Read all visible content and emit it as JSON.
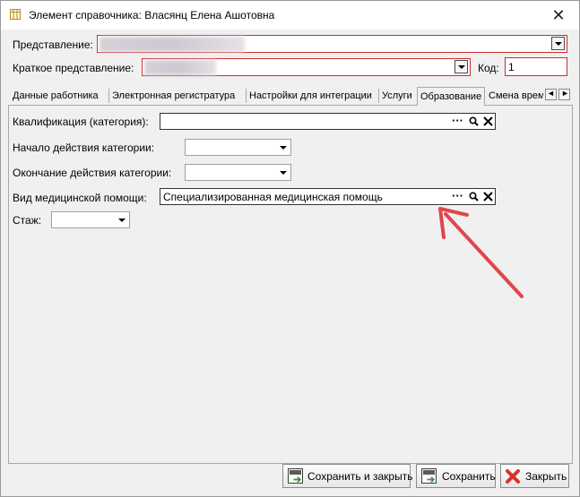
{
  "window": {
    "title": "Элемент справочника: Власянц Елена Ашотовна",
    "close_glyph": "✕"
  },
  "header": {
    "representation_label": "Представление:",
    "short_representation_label": "Краткое представление:",
    "code_label": "Код:",
    "code_value": "1"
  },
  "tabs": [
    {
      "label": "Данные работника"
    },
    {
      "label": "Электронная регистратура"
    },
    {
      "label": "Настройки для интеграции"
    },
    {
      "label": "Услуги"
    },
    {
      "label": "Образование"
    },
    {
      "label": "Смена врем"
    }
  ],
  "tab_nav": {
    "prev": "◄",
    "next": "►"
  },
  "form": {
    "qualification_label": "Квалификация (категория):",
    "qualification_value": "",
    "category_start_label": "Начало действия категории:",
    "category_end_label": "Окончание действия категории:",
    "care_type_label": "Вид медицинской помощи:",
    "care_type_value": "Специализированная медицинская помощь",
    "experience_label": "Стаж:"
  },
  "field_buttons": {
    "select": "···",
    "search": "🔍",
    "clear": "✕"
  },
  "buttons": {
    "save_close": "Сохранить и закрыть",
    "save": "Сохранить",
    "close": "Закрыть"
  },
  "colors": {
    "accent_red": "#d22a2a",
    "arrow": "#e0464a"
  }
}
